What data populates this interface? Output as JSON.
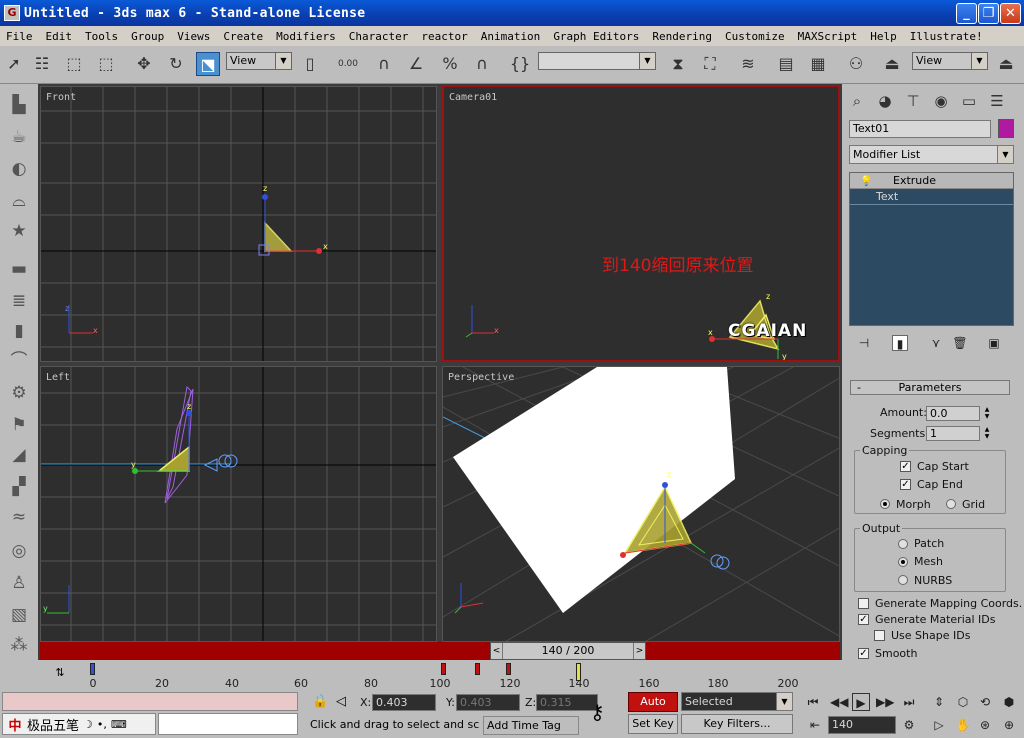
{
  "window": {
    "title": "Untitled - 3ds max 6 - Stand-alone License",
    "min": "_",
    "max": "❐",
    "close": "✕"
  },
  "menu": [
    "File",
    "Edit",
    "Tools",
    "Group",
    "Views",
    "Create",
    "Modifiers",
    "Character",
    "reactor",
    "Animation",
    "Graph Editors",
    "Rendering",
    "Customize",
    "MAXScript",
    "Help",
    "Illustrate!"
  ],
  "toolbar": {
    "ref_coord": "View",
    "snap_value": "0.00",
    "render_view": "View"
  },
  "viewports": {
    "front": "Front",
    "camera": "Camera01",
    "left": "Left",
    "perspective": "Perspective",
    "camera_annotation": "到140缩回原来位置",
    "logo_text": "CGAIAN"
  },
  "command_panel": {
    "object_name": "Text01",
    "object_color": "#b01aa0",
    "modifier_list": "Modifier List",
    "stack": [
      "Extrude",
      "Text"
    ],
    "parameters": {
      "title": "Parameters",
      "amount_label": "Amount:",
      "amount": "0.0",
      "segments_label": "Segments:",
      "segments": "1",
      "capping_title": "Capping",
      "cap_start": "Cap Start",
      "cap_end": "Cap End",
      "morph": "Morph",
      "grid": "Grid",
      "output_title": "Output",
      "patch": "Patch",
      "mesh": "Mesh",
      "nurbs": "NURBS",
      "gen_mapping": "Generate Mapping Coords.",
      "gen_material": "Generate Material IDs",
      "use_shape": "Use Shape IDs",
      "smooth": "Smooth"
    }
  },
  "timeline": {
    "slider_text": "140 / 200",
    "ticks": [
      "0",
      "20",
      "40",
      "60",
      "80",
      "100",
      "120",
      "140",
      "160",
      "180",
      "200"
    ]
  },
  "status": {
    "ime_label": "极品五笔",
    "coord_x_label": "X:",
    "coord_x": "0.403",
    "coord_y_label": "Y:",
    "coord_y": "0.403",
    "coord_z_label": "Z:",
    "coord_z": "0.315",
    "status_text": "Click and drag to select and scale o",
    "add_time_tag": "Add Time Tag",
    "auto_key": "Auto Key",
    "set_key": "Set Key",
    "selected": "Selected",
    "key_filters": "Key Filters...",
    "current_frame": "140"
  }
}
